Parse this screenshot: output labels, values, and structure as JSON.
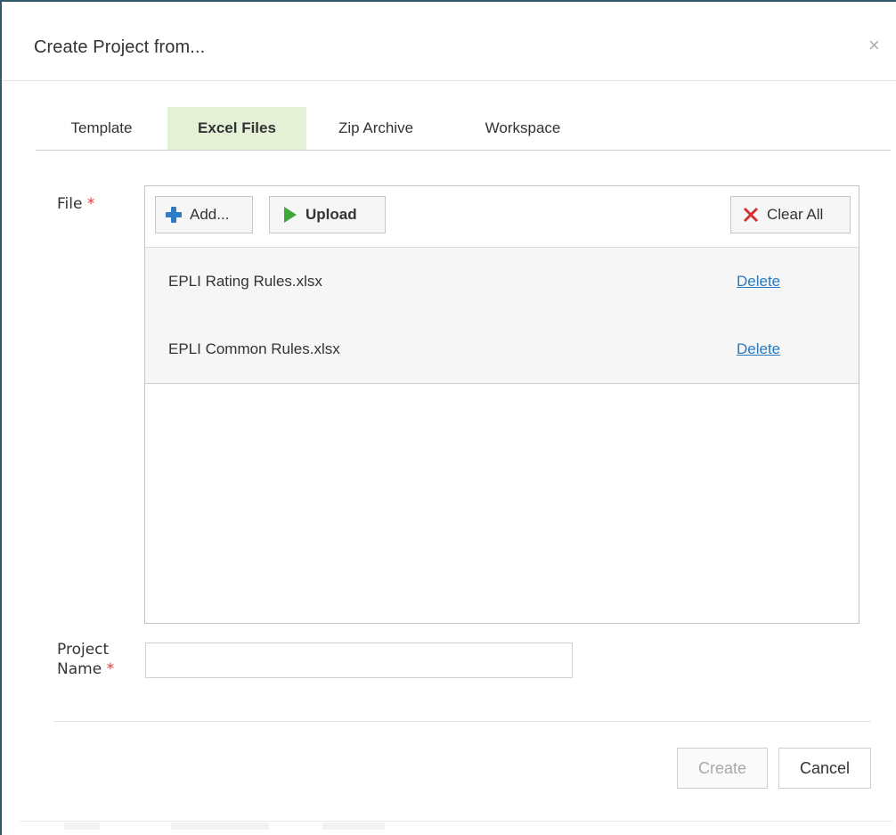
{
  "dialog": {
    "title": "Create Project from...",
    "close_symbol": "×"
  },
  "tabs": [
    {
      "label": "Template",
      "active": false
    },
    {
      "label": "Excel Files",
      "active": true
    },
    {
      "label": "Zip Archive",
      "active": false
    },
    {
      "label": "Workspace",
      "active": false
    }
  ],
  "file_section": {
    "label": "File",
    "required_mark": "*",
    "toolbar": {
      "add_label": "Add...",
      "upload_label": "Upload",
      "clear_all_label": "Clear All"
    },
    "files": [
      {
        "name": "EPLI Rating Rules.xlsx",
        "action": "Delete"
      },
      {
        "name": "EPLI Common Rules.xlsx",
        "action": "Delete"
      }
    ]
  },
  "project_name": {
    "label_line1": "Project",
    "label_line2": "Name",
    "required_mark": "*",
    "value": "",
    "placeholder": ""
  },
  "footer": {
    "create_label": "Create",
    "cancel_label": "Cancel"
  },
  "colors": {
    "active_tab_bg": "#e4f1d6",
    "required": "#e53935",
    "link": "#2a7ac0",
    "add_icon": "#2d7cc4",
    "upload_icon": "#3ea83a",
    "clear_icon": "#d32f2f",
    "border_frame": "#2f5a6e"
  },
  "icons": {
    "add": "plus-icon",
    "upload": "play-arrow-icon",
    "clear": "x-icon",
    "close": "close-icon"
  }
}
